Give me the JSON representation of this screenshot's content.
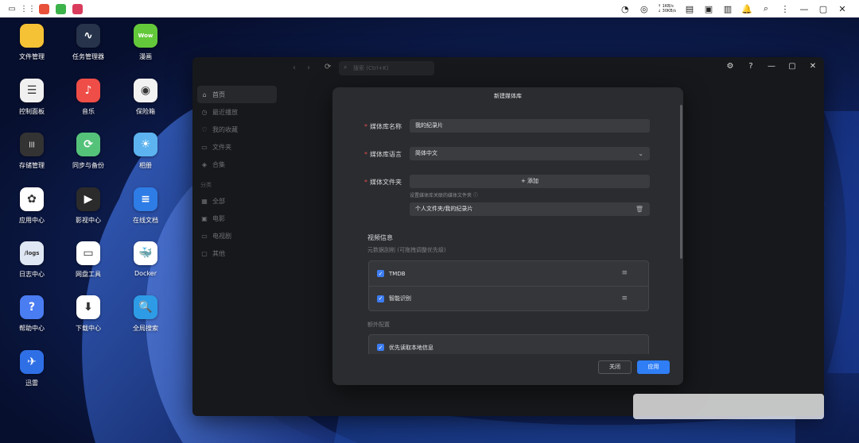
{
  "topbar": {
    "net_up": "↑ 1KB/s",
    "net_down": "↓ 30KB/s"
  },
  "desktop": {
    "icons": [
      {
        "label": "文件管理",
        "icon": "folder-icon",
        "color": "#f6c235",
        "glyph": ""
      },
      {
        "label": "任务管理器",
        "icon": "task-manager-icon",
        "color": "#26334a",
        "glyph": "∿"
      },
      {
        "label": "漫画",
        "icon": "comic-icon",
        "color": "#64c93a",
        "glyph": "Wow"
      },
      {
        "label": "控制面板",
        "icon": "control-panel-icon",
        "color": "#f0f0f0",
        "glyph": "☰"
      },
      {
        "label": "音乐",
        "icon": "music-icon",
        "color": "#ef4d47",
        "glyph": "♪"
      },
      {
        "label": "保险箱",
        "icon": "safe-icon",
        "color": "#f2f2f2",
        "glyph": "◉"
      },
      {
        "label": "存储管理",
        "icon": "storage-icon",
        "color": "#333",
        "glyph": "|||"
      },
      {
        "label": "同步与备份",
        "icon": "sync-icon",
        "color": "#55c27a",
        "glyph": "⟳"
      },
      {
        "label": "相册",
        "icon": "photos-icon",
        "color": "#5cb3ef",
        "glyph": "☀"
      },
      {
        "label": "应用中心",
        "icon": "app-center-icon",
        "color": "#ffffff",
        "glyph": "✿"
      },
      {
        "label": "影视中心",
        "icon": "video-center-icon",
        "color": "#2b2b2b",
        "glyph": "▶"
      },
      {
        "label": "在线文档",
        "icon": "online-docs-icon",
        "color": "#2e7ce6",
        "glyph": "≡"
      },
      {
        "label": "日志中心",
        "icon": "logs-icon",
        "color": "#dfe7f4",
        "glyph": "/logs"
      },
      {
        "label": "网盘工具",
        "icon": "cloud-drive-icon",
        "color": "#ffffff",
        "glyph": "▭"
      },
      {
        "label": "Docker",
        "icon": "docker-icon",
        "color": "#ffffff",
        "glyph": "🐳"
      },
      {
        "label": "帮助中心",
        "icon": "help-icon",
        "color": "#4a7cf2",
        "glyph": "?"
      },
      {
        "label": "下载中心",
        "icon": "download-icon",
        "color": "#ffffff",
        "glyph": "⬇"
      },
      {
        "label": "全局搜索",
        "icon": "global-search-icon",
        "color": "#2e9be6",
        "glyph": "🔍"
      },
      {
        "label": "迅雷",
        "icon": "thunder-icon",
        "color": "#2f6fe6",
        "glyph": "✈"
      }
    ]
  },
  "window": {
    "search_placeholder": "搜索 (Ctrl+K)",
    "sidebar": {
      "items": [
        {
          "label": "首页",
          "icon": "home-icon",
          "glyph": "⌂"
        },
        {
          "label": "最近播放",
          "icon": "clock-icon",
          "glyph": "◷"
        },
        {
          "label": "我的收藏",
          "icon": "heart-icon",
          "glyph": "♡"
        },
        {
          "label": "文件夹",
          "icon": "folder-outline-icon",
          "glyph": "▭"
        },
        {
          "label": "合集",
          "icon": "stack-icon",
          "glyph": "◈"
        }
      ],
      "group_title": "分类",
      "categories": [
        {
          "label": "全部",
          "icon": "grid-icon",
          "glyph": "▦"
        },
        {
          "label": "电影",
          "icon": "film-icon",
          "glyph": "▣"
        },
        {
          "label": "电视剧",
          "icon": "tv-icon",
          "glyph": "▭"
        },
        {
          "label": "其他",
          "icon": "other-icon",
          "glyph": "▢"
        }
      ]
    }
  },
  "dialog": {
    "title": "新建媒体库",
    "name_label": "媒体库名称",
    "name_value": "我的纪录片",
    "lang_label": "媒体库语言",
    "lang_value": "简体中文",
    "folder_label": "媒体文件夹",
    "add_label": "+ 添加",
    "hint": "设置媒体库关联的媒体文件夹 ⓘ",
    "folder_path": "个人文件夹/我的纪录片",
    "video_info_title": "视频信息",
    "metadata_title": "元数据刮削 (可拖拽调整优先级)",
    "scrapers": [
      {
        "label": "TMDB",
        "checked": true
      },
      {
        "label": "智能识别",
        "checked": true
      }
    ],
    "extra_title": "额外配置",
    "extra_options": [
      {
        "label": "优先读取本地信息",
        "checked": true
      }
    ],
    "close_label": "关闭",
    "apply_label": "应用"
  }
}
